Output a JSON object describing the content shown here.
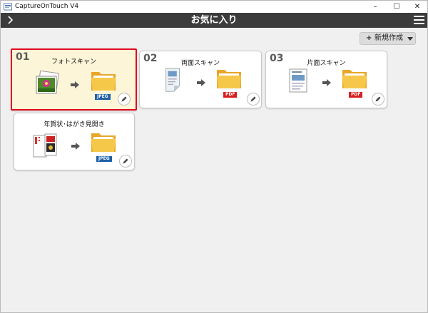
{
  "window": {
    "title": "CaptureOnTouch V4"
  },
  "window_controls": [
    "–",
    "☐",
    "✕"
  ],
  "navbar": {
    "title": "お気に入り"
  },
  "toolbar": {
    "new_plus": "+",
    "new_label": "新規作成"
  },
  "colors": {
    "navbar_bg": "#3c3c3c",
    "selected_border": "#e0001b",
    "selected_bg": "#fdf5d8",
    "jpeg_badge": "#1f5fa8",
    "pdf_badge": "#d81e1e"
  },
  "cards": [
    {
      "number": "01",
      "name": "フォトスキャン",
      "source_icon": "photo-icon",
      "format": "JPEG",
      "selected": true
    },
    {
      "number": "02",
      "name": "両面スキャン",
      "source_icon": "duplex-document-icon",
      "format": "PDF",
      "selected": false
    },
    {
      "number": "03",
      "name": "片面スキャン",
      "source_icon": "single-document-icon",
      "format": "PDF",
      "selected": false
    },
    {
      "number": "",
      "name": "年賀状･はがき見開き",
      "source_icon": "postcard-icon",
      "format": "JPEG",
      "selected": false
    }
  ]
}
